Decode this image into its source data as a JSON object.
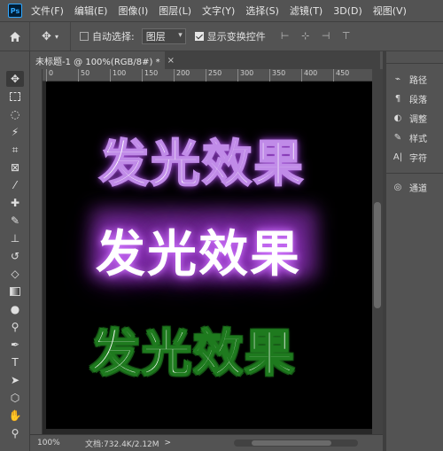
{
  "app": {
    "logo": "Ps"
  },
  "menu": [
    "文件(F)",
    "编辑(E)",
    "图像(I)",
    "图层(L)",
    "文字(Y)",
    "选择(S)",
    "滤镜(T)",
    "3D(D)",
    "视图(V)"
  ],
  "options": {
    "move_icon": "✥",
    "auto_select_label": "自动选择:",
    "auto_select_value": "图层",
    "show_transform_label": "显示变换控件"
  },
  "document": {
    "tab_title": "未标题-1 @ 100%(RGB/8#) *",
    "close": "×"
  },
  "ruler": {
    "ticks": [
      "0",
      "50",
      "100",
      "150",
      "200",
      "250",
      "300",
      "350",
      "400",
      "450"
    ]
  },
  "canvas": {
    "text_1": "发光效果",
    "text_2": "发光效果",
    "text_3": "发光效果",
    "colors": {
      "glow_purple": "#b54ee8",
      "glow_green": "#1e7a1e",
      "background": "#000000"
    }
  },
  "status": {
    "zoom": "100%",
    "doc_info": "文档:732.4K/2.12M",
    "arrow": ">"
  },
  "panels": {
    "items": [
      {
        "label": "路径",
        "icon": "paths-icon",
        "glyph": "⌁"
      },
      {
        "label": "段落",
        "icon": "paragraph-icon",
        "glyph": "¶"
      },
      {
        "label": "调整",
        "icon": "adjustments-icon",
        "glyph": "◐"
      },
      {
        "label": "样式",
        "icon": "styles-icon",
        "glyph": "✎"
      },
      {
        "label": "字符",
        "icon": "character-icon",
        "glyph": "A|"
      }
    ],
    "channels": {
      "label": "通道",
      "icon": "channels-icon",
      "glyph": "◎"
    }
  }
}
